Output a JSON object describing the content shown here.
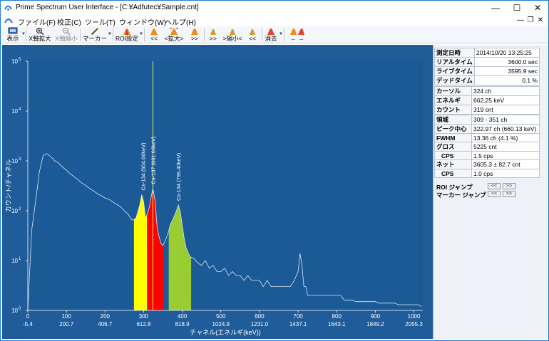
{
  "window": {
    "title": "Prime Spectrum User Interface - [C:¥Adfutec¥Sample.cnt]",
    "minimize": "—",
    "maximize": "☐",
    "close": "✕"
  },
  "menu": {
    "items": [
      "ファイル(F)",
      "校正(C)",
      "ツール(T)",
      "ウィンドウ(W)",
      "ヘルプ(H)"
    ],
    "mdi_minimize": "—",
    "mdi_restore": "❐",
    "mdi_close": "✕"
  },
  "toolbar": {
    "display": "表示",
    "x_zoom_in": "X軸拡大",
    "x_zoom_out": "X軸縮小",
    "marker": "マーカー",
    "roi_settings": "ROI設定",
    "roi_prev": "<<",
    "roi_zoom": "<拡大>",
    "roi_next": ">>",
    "mk_next": ">>",
    "mk_zoom": ">縮小<",
    "mk_prev": "<<",
    "erase": "消去",
    "arrows": "← →"
  },
  "info": {
    "rows1": [
      {
        "key": "測定日時",
        "value": "2014/10/20 13:25:25"
      },
      {
        "key": "リアルタイム",
        "value": "3600.0 sec"
      },
      {
        "key": "ライブタイム",
        "value": "3595.9 sec"
      },
      {
        "key": "デッドタイム",
        "value": "0.1 %"
      }
    ],
    "rows2": [
      {
        "key": "カーソル",
        "value": "324 ch"
      },
      {
        "key": "エネルギ",
        "value": "662.25 keV"
      },
      {
        "key": "カウント",
        "value": "319 cnt"
      }
    ],
    "rows3": [
      {
        "key": "領域",
        "value": "309 - 351 ch"
      },
      {
        "key": "ピーク中心",
        "value": "322.97 ch (660.13 keV)"
      },
      {
        "key": "FWHM",
        "value": "13.36 ch (4.1 %)"
      },
      {
        "key": "グロス",
        "value": "5225 cnt"
      },
      {
        "key": "CPS",
        "value": "1.5 cps"
      },
      {
        "key": "ネット",
        "value": "3605.3 ± 82.7 cnt"
      },
      {
        "key": "CPS",
        "value": "1.0 cps"
      }
    ],
    "roi_jump": "ROI ジャンプ",
    "marker_jump": "マーカー ジャンプ",
    "jump_prev": "<<",
    "jump_next": ">>"
  },
  "chart_data": {
    "type": "area",
    "xlabel": "チャネル(エネルギ(keV))",
    "ylabel": "カウント/チャネル",
    "y_scale": "log",
    "ylim": [
      1,
      100000
    ],
    "xlim": [
      0,
      1023
    ],
    "grid": false,
    "channel_ticks": [
      "0",
      "100",
      "200",
      "300",
      "400",
      "500",
      "600",
      "700",
      "800",
      "900",
      "1000"
    ],
    "energy_ticks": [
      "-5.4",
      "200.7",
      "406.7",
      "612.8",
      "818.9",
      "1024.9",
      "1231.0",
      "1437.1",
      "1643.1",
      "1849.2",
      "2055.3"
    ],
    "y_tick_values": [
      1,
      10,
      100,
      1000,
      10000,
      100000
    ],
    "cursor_channel": 324,
    "spectrum": {
      "channels": [
        0,
        10,
        20,
        30,
        40,
        50,
        60,
        70,
        80,
        90,
        100,
        110,
        120,
        130,
        140,
        150,
        160,
        170,
        180,
        190,
        200,
        210,
        220,
        230,
        240,
        250,
        260,
        270,
        280,
        290,
        295,
        300,
        305,
        310,
        315,
        320,
        324,
        330,
        335,
        340,
        345,
        350,
        355,
        360,
        365,
        370,
        375,
        380,
        385,
        390,
        395,
        400,
        405,
        410,
        420,
        430,
        440,
        450,
        460,
        470,
        480,
        490,
        500,
        510,
        520,
        530,
        540,
        550,
        560,
        570,
        580,
        590,
        600,
        610,
        620,
        630,
        640,
        650,
        660,
        670,
        680,
        690,
        700,
        705,
        710,
        715,
        720,
        725,
        730,
        740,
        750,
        760,
        770,
        780,
        790,
        800,
        810,
        820,
        830,
        840,
        850,
        860,
        870,
        880,
        890,
        900,
        910,
        920,
        930,
        940,
        950,
        960,
        970,
        980,
        990,
        1000,
        1010,
        1020
      ],
      "counts": [
        1,
        40,
        150,
        600,
        1300,
        1400,
        1200,
        1000,
        900,
        750,
        650,
        550,
        480,
        420,
        360,
        320,
        280,
        250,
        220,
        200,
        180,
        170,
        150,
        135,
        120,
        100,
        85,
        65,
        70,
        130,
        210,
        150,
        70,
        90,
        120,
        200,
        280,
        150,
        45,
        30,
        22,
        20,
        24,
        30,
        40,
        55,
        65,
        80,
        100,
        130,
        95,
        50,
        28,
        18,
        12,
        11,
        9,
        8,
        10,
        7,
        8,
        6,
        6,
        7,
        5,
        6,
        5,
        5,
        4,
        5,
        4,
        4,
        4,
        3,
        4,
        3,
        3,
        3,
        3,
        3,
        3,
        4,
        6,
        14,
        8,
        3,
        3,
        2,
        2,
        2,
        2,
        2,
        2,
        2,
        2,
        2,
        2,
        1.6,
        1.6,
        1.6,
        1.5,
        1.5,
        1.5,
        1.5,
        1.5,
        1.5,
        1.4,
        1.4,
        1.4,
        1.4,
        1.4,
        1.3,
        1.3,
        1.3,
        1.3,
        1.3,
        1.3,
        1.2
      ]
    },
    "roi_regions": [
      {
        "start": 275,
        "end": 309,
        "color": "#ffff00"
      },
      {
        "start": 309,
        "end": 351,
        "color": "#ff0000"
      },
      {
        "start": 365,
        "end": 423,
        "color": "#9acd32"
      }
    ],
    "peak_labels": [
      {
        "text": "Cs-134 (604.66keV)",
        "channel": 298,
        "count": 210
      },
      {
        "text": "Cs-137 (661.66keV)",
        "channel": 324,
        "count": 280
      },
      {
        "text": "Cs-134 (796.40keV)",
        "channel": 390,
        "count": 130
      }
    ],
    "colors": {
      "background": "#1f5c99",
      "plot": "#1c5a97",
      "line": "#d9e6f2",
      "axis_text": "#ffffff",
      "cursor": "#d0f070"
    }
  }
}
